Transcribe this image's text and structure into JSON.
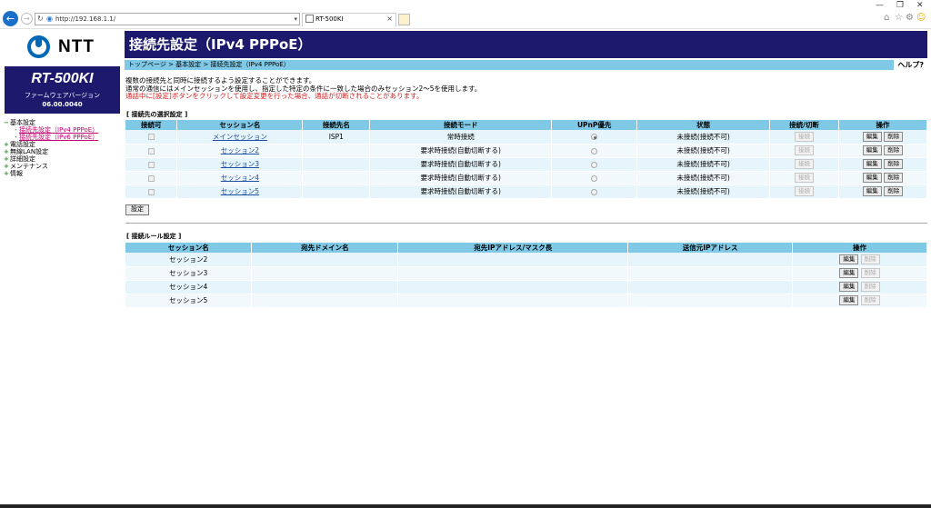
{
  "browser": {
    "url": "http://192.168.1.1/",
    "tab_title": "RT-500KI",
    "tab_close": "×",
    "back_glyph": "←",
    "forward_glyph": "→",
    "minimize": "—",
    "restore": "❐",
    "close": "✕",
    "home_icon": "⌂",
    "star_icon": "☆",
    "gear_icon": "⚙",
    "smiley_icon": "☺"
  },
  "sidebar": {
    "logo_text": "NTT",
    "model": "RT-500KI",
    "firmware_label": "ファームウェアバージョン",
    "firmware_version": "06.00.0040",
    "tree": [
      {
        "label": "基本設定",
        "mark": "−"
      },
      {
        "label": "接続先設定（IPv4 PPPoE）",
        "sub": true
      },
      {
        "label": "接続先設定（IPv6 PPPoE）",
        "sub": true
      },
      {
        "label": "電話設定",
        "mark": "+"
      },
      {
        "label": "無線LAN設定",
        "mark": "+"
      },
      {
        "label": "詳細設定",
        "mark": "+"
      },
      {
        "label": "メンテナンス",
        "mark": "+"
      },
      {
        "label": "情報",
        "mark": "+"
      }
    ]
  },
  "page": {
    "title": "接続先設定（IPv4 PPPoE）",
    "breadcrumb": "トップページ > 基本設定 > 接続先設定（IPv4 PPPoE）",
    "help": "ヘルプ?",
    "desc1": "複数の接続先と同時に接続するよう設定することができます。",
    "desc2": "通常の通信にはメインセッションを使用し、指定した特定の条件に一致した場合のみセッション2〜5を使用します。",
    "desc3": "通話中に[設定]ボタンをクリックして設定変更を行った場合、通話が切断されることがあります。",
    "section1": "[ 接続先の選択設定 ]",
    "section2": "[ 接続ルール設定 ]",
    "set_button": "設定"
  },
  "sessions_table": {
    "headers": [
      "接続可",
      "セッション名",
      "接続先名",
      "接続モード",
      "UPnP優先",
      "状態",
      "接続/切断",
      "操作"
    ],
    "connect_label": "接続",
    "edit_label": "編集",
    "delete_label": "削除",
    "rows": [
      {
        "name": "メインセッション",
        "dest": "ISP1",
        "mode": "常時接続",
        "upnp": true,
        "status": "未接続(接続不可)"
      },
      {
        "name": "セッション2",
        "dest": "",
        "mode": "要求時接続(自動切断する)",
        "upnp": false,
        "status": "未接続(接続不可)"
      },
      {
        "name": "セッション3",
        "dest": "",
        "mode": "要求時接続(自動切断する)",
        "upnp": false,
        "status": "未接続(接続不可)"
      },
      {
        "name": "セッション4",
        "dest": "",
        "mode": "要求時接続(自動切断する)",
        "upnp": false,
        "status": "未接続(接続不可)"
      },
      {
        "name": "セッション5",
        "dest": "",
        "mode": "要求時接続(自動切断する)",
        "upnp": false,
        "status": "未接続(接続不可)"
      }
    ]
  },
  "rules_table": {
    "headers": [
      "セッション名",
      "宛先ドメイン名",
      "宛先IPアドレス/マスク長",
      "送信元IPアドレス",
      "操作"
    ],
    "edit_label": "編集",
    "delete_label": "削除",
    "rows": [
      {
        "name": "セッション2"
      },
      {
        "name": "セッション3"
      },
      {
        "name": "セッション4"
      },
      {
        "name": "セッション5"
      }
    ]
  }
}
